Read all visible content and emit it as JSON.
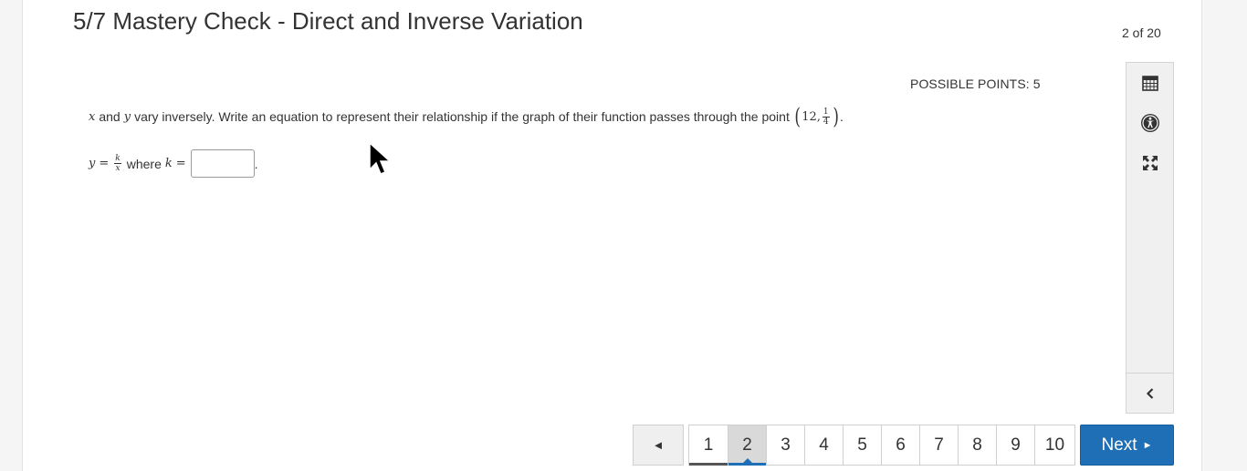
{
  "header": {
    "title": "5/7 Mastery Check - Direct and Inverse Variation",
    "counter": "2 of 20"
  },
  "question": {
    "possible_points": "POSSIBLE POINTS: 5",
    "var_x": "x",
    "and_text": "and",
    "var_y": "y",
    "text": "vary inversely. Write an equation to represent their relationship if the graph of their function passes through the point",
    "point_x": "12,",
    "point_y_num": "1",
    "point_y_den": "4",
    "end_period": "."
  },
  "answer": {
    "eq_y": "y",
    "eq_equals": "=",
    "frac_num": "k",
    "frac_den": "x",
    "where_text": "where",
    "eq_k": "k",
    "eq_equals2": "=",
    "input_value": "",
    "period": "."
  },
  "sidebar": {
    "tools": [
      "calendar-icon",
      "accessibility-icon",
      "expand-icon"
    ],
    "collapse_icon": "chevron-left-icon"
  },
  "pager": {
    "prev_label": "◄",
    "pages": [
      "1",
      "2",
      "3",
      "4",
      "5",
      "6",
      "7",
      "8",
      "9",
      "10"
    ],
    "current_page": "2",
    "next_label": "Next",
    "next_arrow": "►"
  },
  "colors": {
    "accent": "#1e6fb5",
    "current_page_bg": "#d9d9d9"
  }
}
